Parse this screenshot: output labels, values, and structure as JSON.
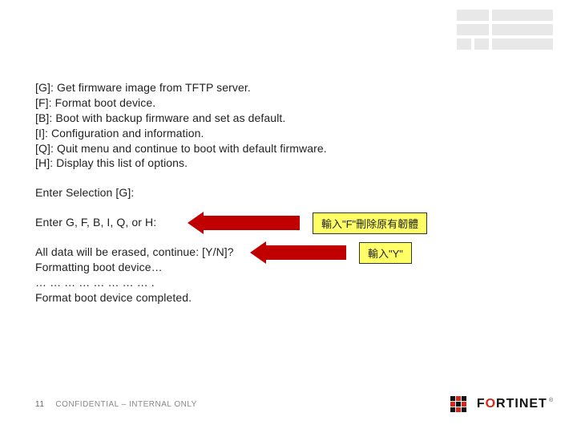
{
  "menu": {
    "g": "[G]:  Get firmware image from TFTP server.",
    "f": "[F]:  Format boot device.",
    "b": "[B]:  Boot with backup firmware and set as default.",
    "i": "[I]:  Configuration and information.",
    "q": "[Q]:  Quit menu and continue to boot with default firmware.",
    "h": "[H]:  Display this list of options."
  },
  "prompts": {
    "enter_selection": "Enter Selection [G]:",
    "enter_keys": "Enter G, F, B, I, Q, or H:",
    "erase_confirm": "All data will be erased, continue: [Y/N]?",
    "formatting": "Formatting boot device…",
    "dots": "… … … … … … … … .",
    "completed": "Format boot device completed."
  },
  "callouts": {
    "c1": "輸入\"F\"刪除原有韌體",
    "c2": "輸入\"Y\""
  },
  "footer": {
    "page": "11",
    "confidential": "CONFIDENTIAL – INTERNAL ONLY"
  },
  "logo": {
    "word_black": "F",
    "word_red": "O",
    "word_rest": "RTINET",
    "tm": "®"
  }
}
